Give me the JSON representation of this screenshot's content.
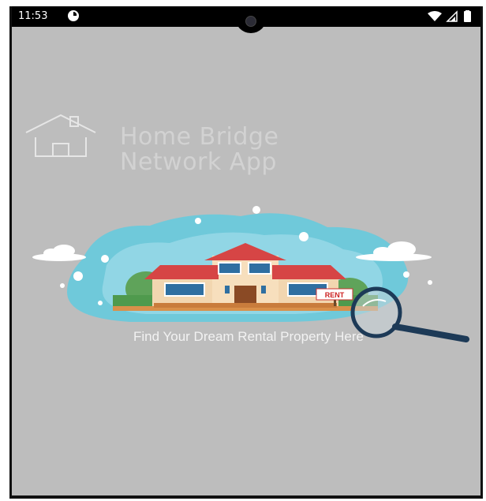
{
  "status_bar": {
    "time": "11:53",
    "icons": [
      "notification-icon",
      "wifi-icon",
      "signal-icon",
      "battery-icon"
    ]
  },
  "app": {
    "title_line1": "Home Bridge",
    "title_line2": "Network App",
    "logo_icon": "house-outline-icon"
  },
  "hero": {
    "sign_text": "RENT",
    "illustration": "house-with-magnifier-illustration"
  },
  "tagline": "Find Your Dream Rental Property Here",
  "colors": {
    "background": "#bdbdbd",
    "title_text": "#d2d2d2",
    "roof": "#d64545",
    "walls": "#f2d6b0",
    "sky_blob": "#6fc9da",
    "magnifier": "#1d3a57"
  }
}
